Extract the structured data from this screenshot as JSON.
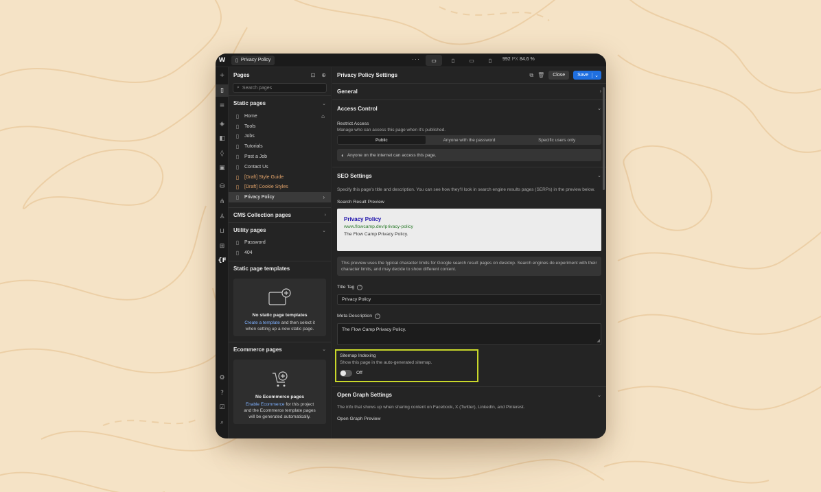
{
  "topbar": {
    "page_name": "Privacy Policy",
    "dots": "···",
    "zoom_px": "992",
    "zoom_unit": "PX",
    "zoom_pct": "84.6 %"
  },
  "pages_panel": {
    "title": "Pages",
    "search_placeholder": "Search pages",
    "static_pages": {
      "label": "Static pages",
      "items": [
        "Home",
        "Tools",
        "Jobs",
        "Tutorials",
        "Post a Job",
        "Contact Us",
        "[Draft] Style Guide",
        "[Draft] Cookie Styles",
        "Privacy Policy"
      ]
    },
    "cms_label": "CMS Collection pages",
    "utility": {
      "label": "Utility pages",
      "items": [
        "Password",
        "404"
      ]
    },
    "templates": {
      "label": "Static page templates",
      "empty_title": "No static page templates",
      "link": "Create a template",
      "text1": " and then select it",
      "text2": "when setting up a new static page."
    },
    "ecommerce": {
      "label": "Ecommerce pages",
      "empty_title": "No Ecommerce pages",
      "link": "Enable Ecommerce",
      "text1": " for this project",
      "text2": "and the Ecommerce template pages",
      "text3": "will be generated automatically."
    }
  },
  "settings": {
    "title": "Privacy Policy Settings",
    "close": "Close",
    "save": "Save",
    "general": "General",
    "access": {
      "label": "Access Control",
      "restrict": "Restrict Access",
      "restrict_desc": "Manage who can access this page when it's published.",
      "options": [
        "Public",
        "Anyone with the password",
        "Specific users only"
      ],
      "info": "Anyone on the internet can access this page."
    },
    "seo": {
      "label": "SEO Settings",
      "desc": "Specify this page's title and description. You can see how they'll look in search engine results pages (SERPs) in the preview below.",
      "preview_label": "Search Result Preview",
      "preview_title": "Privacy Policy",
      "preview_url": "www.flowcamp.dev/privacy-policy",
      "preview_desc": "The Flow Camp Privacy Policy.",
      "note": "This preview uses the typical character limits for Google search result pages on desktop. Search engines do experiment with their character limits, and may decide to show different content.",
      "title_tag_label": "Title Tag",
      "title_tag_value": "Privacy Policy",
      "meta_label": "Meta Description",
      "meta_value": "The Flow Camp Privacy Policy."
    },
    "sitemap": {
      "label": "Sitemap Indexing",
      "desc": "Show this page in the auto-generated sitemap.",
      "state": "Off"
    },
    "og": {
      "label": "Open Graph Settings",
      "desc": "The info that shows up when sharing content on Facebook, X (Twitter), LinkedIn, and Pinterest.",
      "preview_label": "Open Graph Preview"
    }
  },
  "colors": {
    "background": "#f5e3c6",
    "accent": "#1f6fe0",
    "highlight": "#c9d82a",
    "draft": "#e3a46b"
  }
}
